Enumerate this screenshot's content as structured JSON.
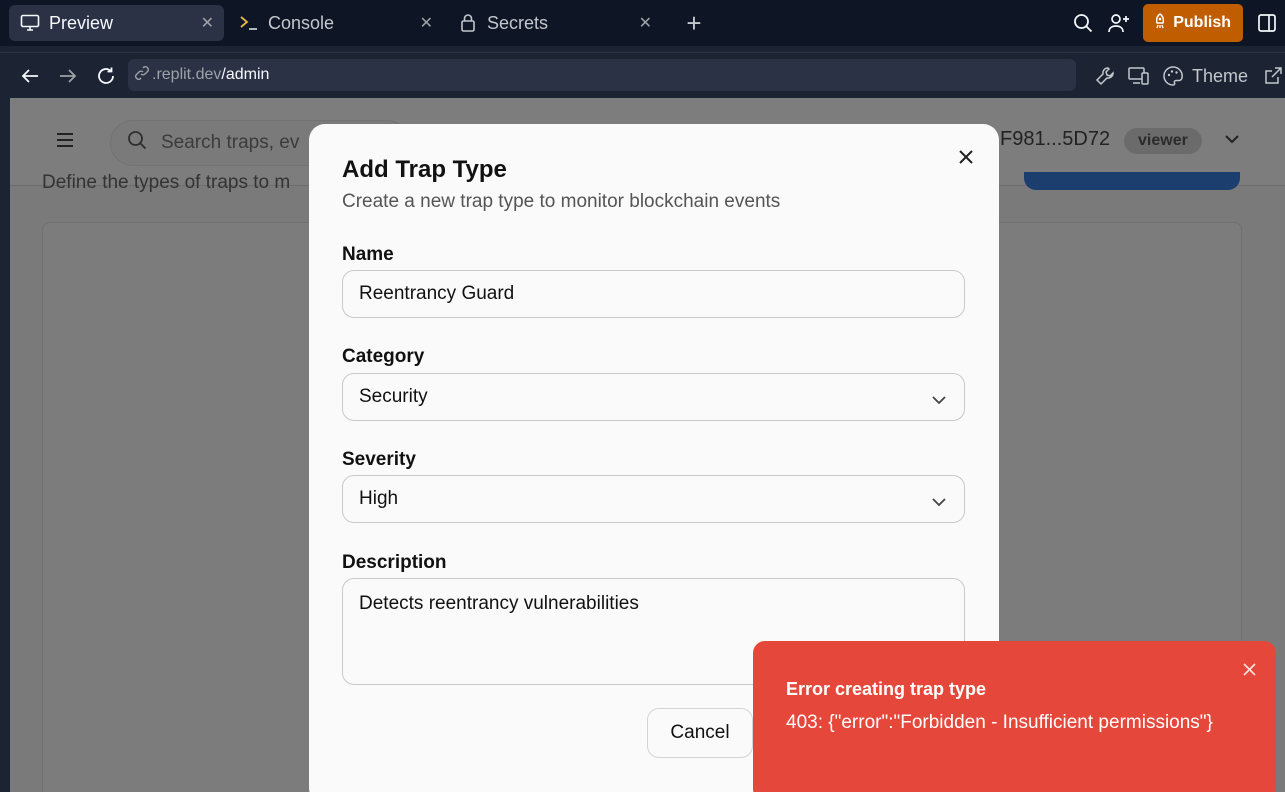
{
  "tabs": [
    {
      "label": "Preview",
      "icon": "monitor-icon",
      "active": true
    },
    {
      "label": "Console",
      "icon": "terminal-icon",
      "active": false
    },
    {
      "label": "Secrets",
      "icon": "lock-icon",
      "active": false
    }
  ],
  "topbar": {
    "publish_label": "Publish"
  },
  "address": {
    "domain": ".replit.dev",
    "path": "/admin",
    "theme_label": "Theme"
  },
  "app": {
    "search_placeholder": "Search traps, ev",
    "wallet": "F981...5D72",
    "role": "viewer",
    "subtitle": "Define the types of traps to m"
  },
  "modal": {
    "title": "Add Trap Type",
    "subtitle": "Create a new trap type to monitor blockchain events",
    "name_label": "Name",
    "name_value": "Reentrancy Guard",
    "category_label": "Category",
    "category_value": "Security",
    "severity_label": "Severity",
    "severity_value": "High",
    "description_label": "Description",
    "description_value": "Detects reentrancy vulnerabilities",
    "cancel_label": "Cancel"
  },
  "toast": {
    "title": "Error creating trap type",
    "message": "403: {\"error\":\"Forbidden - Insufficient permissions\"}"
  },
  "colors": {
    "publish_bg": "#bf5d00",
    "toast_bg": "#e5483a",
    "chrome_bg": "#0e1525"
  }
}
